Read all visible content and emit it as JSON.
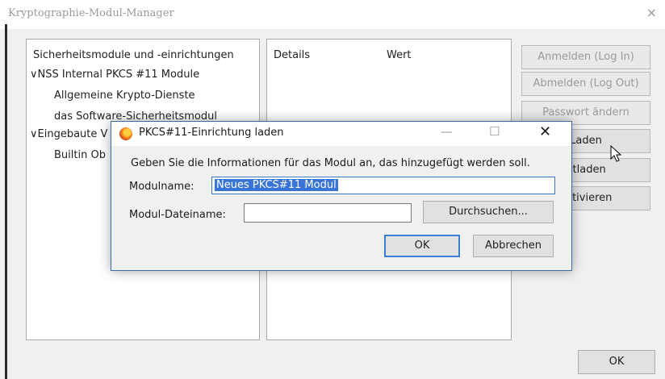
{
  "window": {
    "title": "Kryptographie-Modul-Manager",
    "close_glyph": "×"
  },
  "tree": {
    "header": "Sicherheitsmodule und -einrichtungen",
    "items": [
      {
        "label": "NSS Internal PKCS #11 Module",
        "expanded": true,
        "chevron": "∨"
      },
      {
        "label": "Allgemeine Krypto-Dienste"
      },
      {
        "label": "das Software-Sicherheitsmodul"
      },
      {
        "label": "Eingebaute V",
        "expanded": true,
        "chevron": "∨"
      },
      {
        "label": "Builtin Ob"
      }
    ]
  },
  "details": {
    "col_details": "Details",
    "col_value": "Wert"
  },
  "side_buttons": {
    "login": "Anmelden (Log In)",
    "logout": "Abmelden (Log Out)",
    "change_password": "Passwort ändern",
    "load": "Laden",
    "unload": "ntladen",
    "activate": "aktivieren"
  },
  "ok_main_label": "OK",
  "dialog": {
    "title": "PKCS#11-Einrichtung laden",
    "minimize_glyph": "—",
    "maximize_glyph": "☐",
    "close_glyph": "✕",
    "instruction": "Geben Sie die Informationen für das Modul an, das hinzugefügt werden soll.",
    "module_name_label": "Modulname:",
    "module_name_value": "Neues PKCS#11 Modul",
    "module_file_label": "Modul-Dateiname:",
    "module_file_value": "",
    "browse_label": "Durchsuchen...",
    "ok_label": "OK",
    "cancel_label": "Abbrechen"
  }
}
